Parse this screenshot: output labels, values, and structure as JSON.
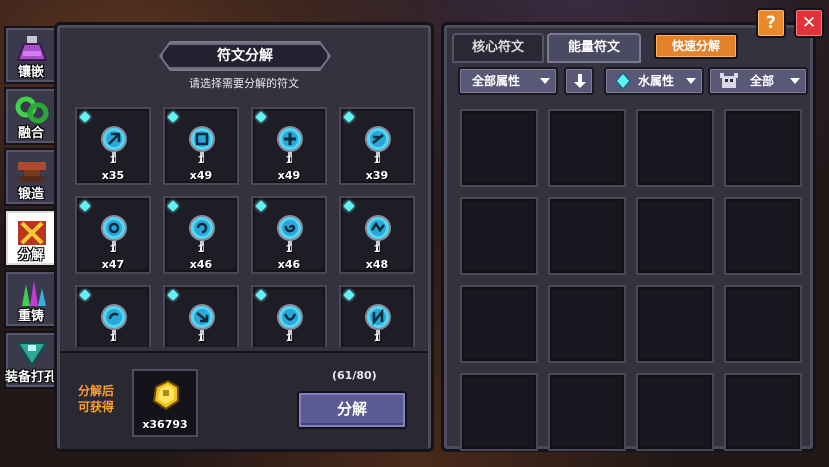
{
  "nav": {
    "items": [
      {
        "label": "镶嵌",
        "icon": "flask-icon"
      },
      {
        "label": "融合",
        "icon": "fusion-rings-icon"
      },
      {
        "label": "锻造",
        "icon": "anvil-icon"
      },
      {
        "label": "分解",
        "icon": "decompose-icon",
        "active": true
      },
      {
        "label": "重铸",
        "icon": "recast-crystals-icon"
      },
      {
        "label": "装备打孔",
        "icon": "drill-icon"
      }
    ]
  },
  "left_panel": {
    "title": "符文分解",
    "instruction": "请选择需要分解的符文",
    "runes": [
      {
        "level": "1",
        "qty": "x35"
      },
      {
        "level": "1",
        "qty": "x49"
      },
      {
        "level": "1",
        "qty": "x49"
      },
      {
        "level": "1",
        "qty": "x39"
      },
      {
        "level": "1",
        "qty": "x47"
      },
      {
        "level": "1",
        "qty": "x46"
      },
      {
        "level": "1",
        "qty": "x46"
      },
      {
        "level": "1",
        "qty": "x48"
      },
      {
        "level": "1",
        "qty": ""
      },
      {
        "level": "1",
        "qty": ""
      },
      {
        "level": "1",
        "qty": ""
      },
      {
        "level": "1",
        "qty": ""
      }
    ],
    "yield_label_line1": "分解后",
    "yield_label_line2": "可获得",
    "yield_qty": "x36793",
    "count": "(61/80)",
    "decompose_button": "分解"
  },
  "right_panel": {
    "tabs": [
      "核心符文",
      "能量符文"
    ],
    "active_tab": 1,
    "quick_button": "快速分解",
    "filter_attr": "全部属性",
    "filter_water": "水属性",
    "filter_all": "全部"
  },
  "top_buttons": {
    "help": "?",
    "close": "✕"
  },
  "colors": {
    "rune_glow": "#4fd8f5",
    "accent_orange": "#e3822a",
    "close_red": "#e0343a"
  }
}
